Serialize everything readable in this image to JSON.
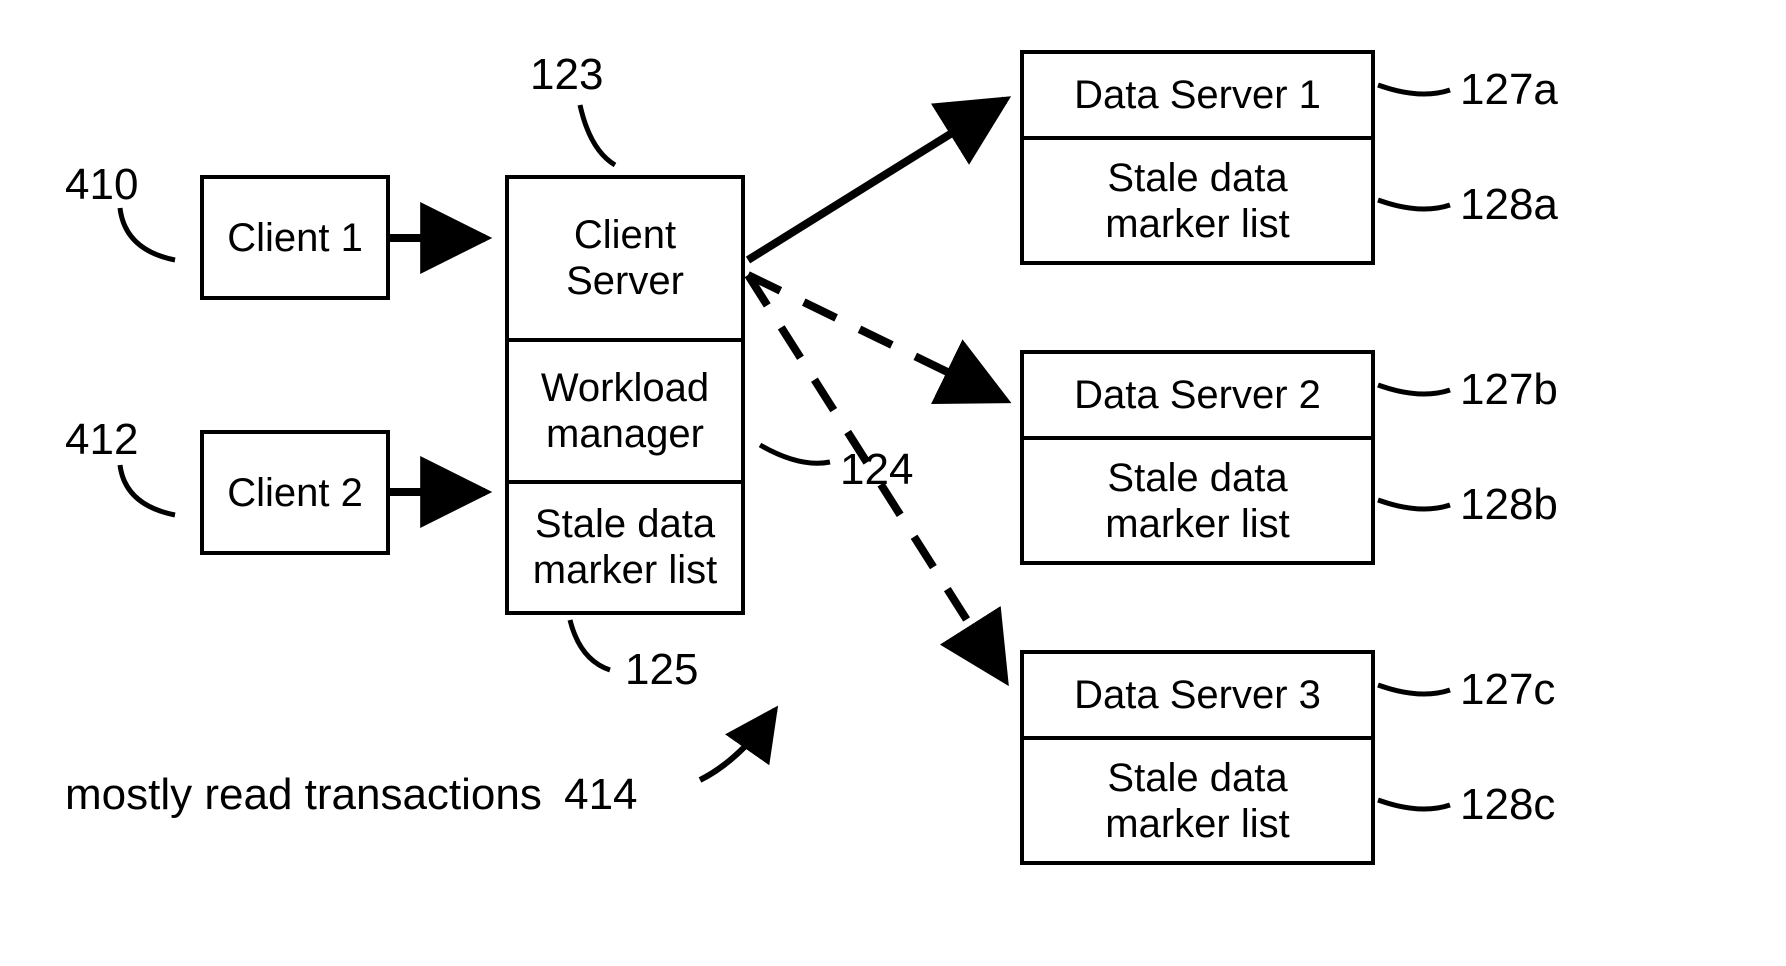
{
  "clients": [
    {
      "label": "Client 1",
      "ref": "410"
    },
    {
      "label": "Client 2",
      "ref": "412"
    }
  ],
  "clientServer": {
    "ref": "123",
    "cells": {
      "server": "Client\nServer",
      "workload": "Workload\nmanager",
      "stale": "Stale data\nmarker list"
    },
    "workloadRef": "124",
    "staleRef": "125"
  },
  "dataServers": [
    {
      "title": "Data Server 1",
      "stale": "Stale data\nmarker list",
      "titleRef": "127a",
      "staleRef": "128a"
    },
    {
      "title": "Data Server 2",
      "stale": "Stale data\nmarker list",
      "titleRef": "127b",
      "staleRef": "128b"
    },
    {
      "title": "Data Server 3",
      "stale": "Stale data\nmarker list",
      "titleRef": "127c",
      "staleRef": "128c"
    }
  ],
  "caption": {
    "text": "mostly read transactions",
    "ref": "414"
  }
}
